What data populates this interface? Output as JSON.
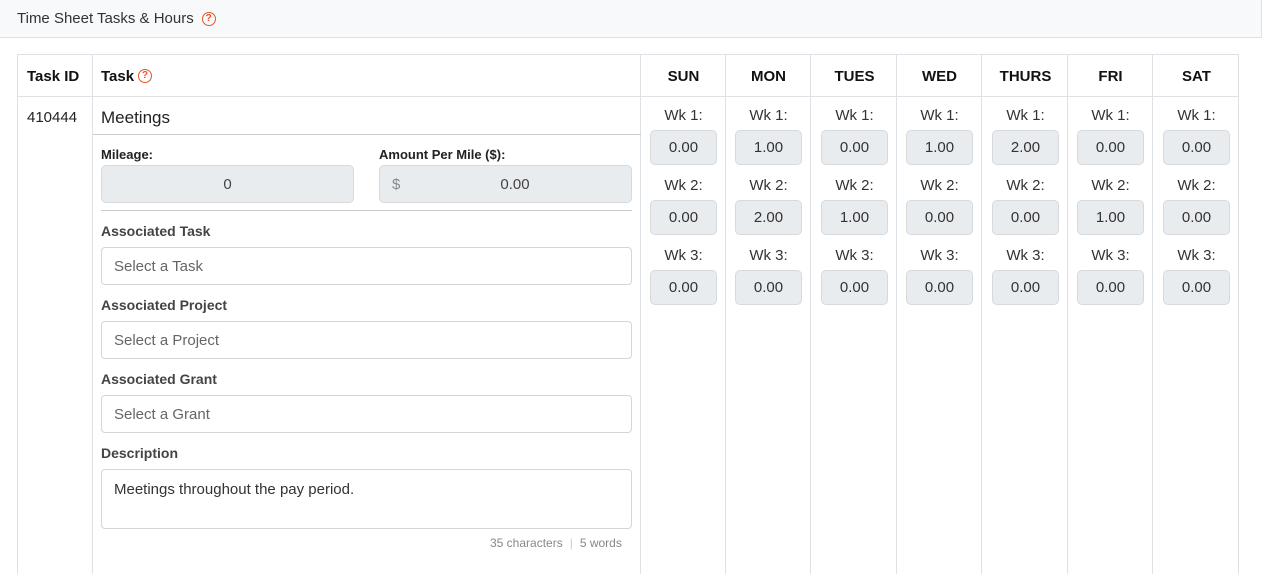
{
  "panel": {
    "title": "Time Sheet Tasks & Hours",
    "help_icon": "question-circle-icon",
    "accent_color": "#e8542c"
  },
  "table": {
    "headers": {
      "task_id": "Task ID",
      "task": "Task",
      "days": [
        "SUN",
        "MON",
        "TUES",
        "WED",
        "THURS",
        "FRI",
        "SAT"
      ]
    },
    "row": {
      "task_id": "410444",
      "task_name": "Meetings",
      "mileage_label": "Mileage:",
      "mileage_value": "0",
      "amount_label": "Amount Per Mile ($):",
      "amount_currency": "$",
      "amount_value": "0.00",
      "assoc_task_label": "Associated Task",
      "assoc_task_placeholder": "Select a Task",
      "assoc_project_label": "Associated Project",
      "assoc_project_placeholder": "Select a Project",
      "assoc_grant_label": "Associated Grant",
      "assoc_grant_placeholder": "Select a Grant",
      "description_label": "Description",
      "description_value": "Meetings throughout the pay period.",
      "char_count": "35 characters",
      "word_count": "5 words"
    },
    "weeks": [
      {
        "label": "Wk 1:",
        "hours": [
          "0.00",
          "1.00",
          "0.00",
          "1.00",
          "2.00",
          "0.00",
          "0.00"
        ]
      },
      {
        "label": "Wk 2:",
        "hours": [
          "0.00",
          "2.00",
          "1.00",
          "0.00",
          "0.00",
          "1.00",
          "0.00"
        ]
      },
      {
        "label": "Wk 3:",
        "hours": [
          "0.00",
          "0.00",
          "0.00",
          "0.00",
          "0.00",
          "0.00",
          "0.00"
        ]
      }
    ]
  }
}
